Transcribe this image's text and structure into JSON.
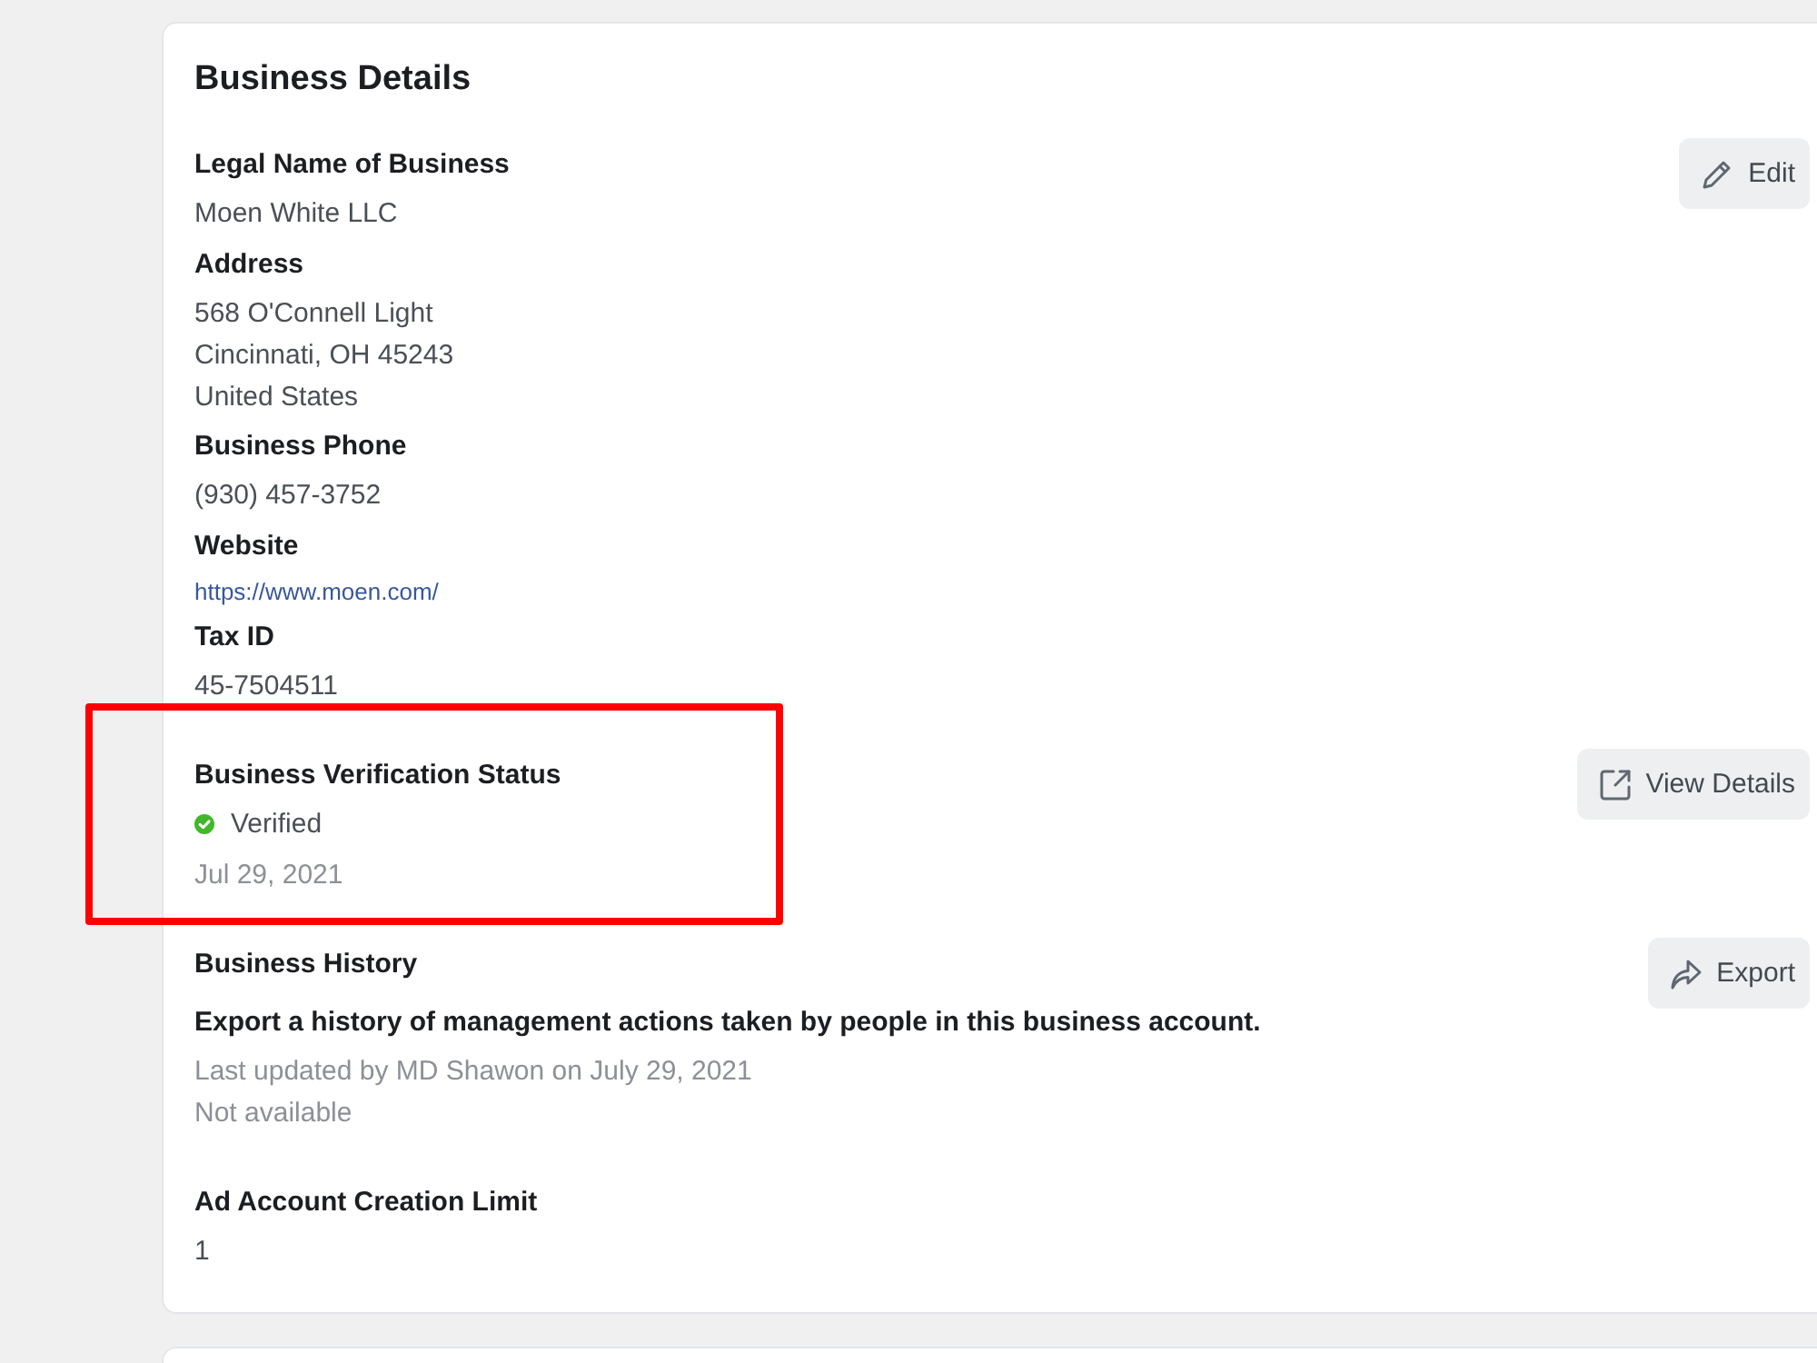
{
  "card": {
    "title": "Business Details",
    "sections": [
      {
        "highlighted": false,
        "button": {
          "kind": "edit",
          "label": "Edit"
        },
        "fields": [
          {
            "label": "Legal Name of Business",
            "lines": [
              {
                "kind": "text",
                "text": "Moen White LLC"
              }
            ]
          },
          {
            "label": "Address",
            "lines": [
              {
                "kind": "text",
                "text": "568 O'Connell Light"
              },
              {
                "kind": "text",
                "text": "Cincinnati, OH 45243"
              },
              {
                "kind": "text",
                "text": "United States"
              }
            ]
          },
          {
            "label": "Business Phone",
            "lines": [
              {
                "kind": "text",
                "text": "(930) 457-3752"
              }
            ]
          },
          {
            "label": "Website",
            "lines": [
              {
                "kind": "link",
                "text": "https://www.moen.com/"
              }
            ]
          },
          {
            "label": "Tax ID",
            "lines": [
              {
                "kind": "text",
                "text": "45-7504511"
              }
            ]
          }
        ]
      },
      {
        "highlighted": true,
        "button": {
          "kind": "open",
          "label": "View Details"
        },
        "fields": [
          {
            "label": "Business Verification Status",
            "lines": [
              {
                "kind": "status",
                "text": "Verified"
              },
              {
                "kind": "muted",
                "text": "Jul 29, 2021"
              }
            ]
          }
        ]
      },
      {
        "highlighted": false,
        "button": {
          "kind": "share",
          "label": "Export"
        },
        "fields": [
          {
            "label": "Business History",
            "lines": [
              {
                "kind": "bold",
                "text": "Export a history of management actions taken by people in this business account."
              },
              {
                "kind": "muted",
                "text": "Last updated by MD Shawon on July 29, 2021"
              },
              {
                "kind": "muted",
                "text": "Not available"
              }
            ]
          }
        ]
      },
      {
        "highlighted": false,
        "fields": [
          {
            "label": "Ad Account Creation Limit",
            "lines": [
              {
                "kind": "text",
                "text": "1"
              }
            ]
          }
        ]
      }
    ]
  }
}
